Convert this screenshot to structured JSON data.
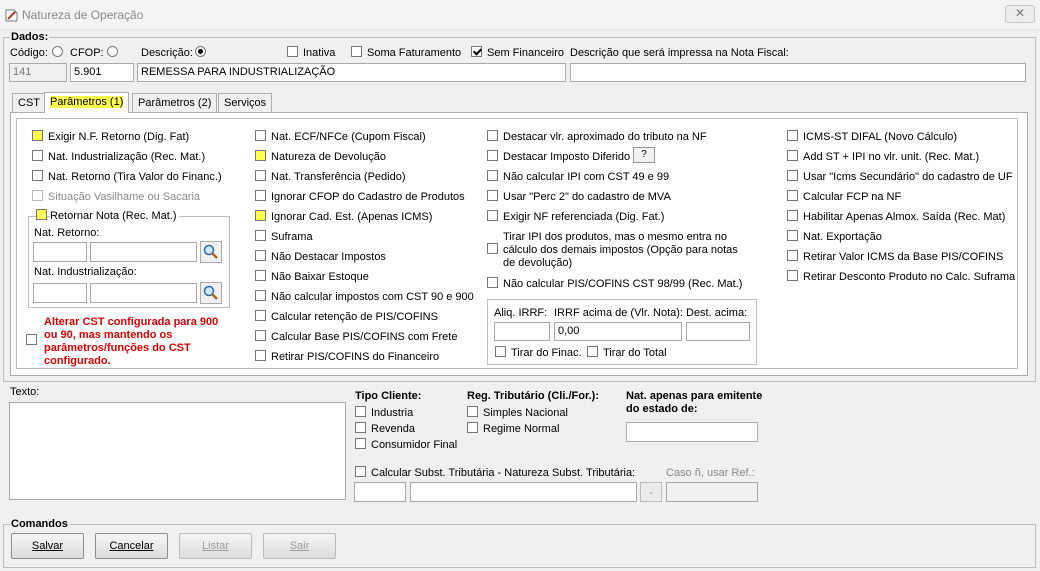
{
  "window": {
    "title": "Natureza de Operação",
    "close": "✕"
  },
  "dados": {
    "legend": "Dados:",
    "codigo_label": "Código:",
    "cfop_label": "CFOP:",
    "descricao_label": "Descrição:",
    "inativa": "Inativa",
    "soma_faturamento": "Soma Faturamento",
    "sem_financeiro": "Sem Financeiro",
    "desc_nf_label": "Descrição que será impressa na Nota Fiscal:",
    "codigo": "141",
    "cfop": "5.901",
    "descricao": "REMESSA PARA INDUSTRIALIZAÇÃO",
    "desc_nf": ""
  },
  "tabs": [
    "CST",
    "Parâmetros (1)",
    "Parâmetros (2)",
    "Serviços"
  ],
  "col1": {
    "exigir_nf": "Exigir N.F. Retorno (Dig. Fat)",
    "nat_industrializacao": "Nat. Industrialização (Rec. Mat.)",
    "nat_retorno": "Nat. Retorno (Tira Valor do Financ.)",
    "situacao_vasilhame": "Situação Vasilhame ou Sacaria",
    "retornar_nota": "Retornar Nota (Rec. Mat.)",
    "nat_retorno_label": "Nat. Retorno:",
    "nat_ind_label": "Nat. Industrialização:",
    "alerta": "Alterar CST configurada para 900 ou 90, mas mantendo os parâmetros/funções do CST configurado."
  },
  "col2": [
    "Nat. ECF/NFCe (Cupom Fiscal)",
    "Natureza de Devolução",
    "Nat. Transferência (Pedido)",
    "Ignorar CFOP do Cadastro de Produtos",
    "Ignorar Cad. Est. (Apenas ICMS)",
    "Suframa",
    "Não Destacar Impostos",
    "Não Baixar Estoque",
    "Não calcular impostos com CST 90 e 900",
    "Calcular retenção de PIS/COFINS",
    "Calcular Base PIS/COFINS com Frete",
    "Retirar PIS/COFINS do Financeiro"
  ],
  "col3": {
    "destacar_vlr": "Destacar vlr. aproximado do tributo na NF",
    "destacar_diferido": "Destacar Imposto Diferido",
    "help": "?",
    "nao_calcular_ipi": "Não calcular IPI com CST 49 e 99",
    "usar_perc2": "Usar \"Perc 2\" do cadastro de MVA",
    "exigir_nf_ref": "Exigir NF referenciada (Dig. Fat.)",
    "tirar_ipi": "Tirar IPI dos produtos, mas o mesmo entra no cálculo dos demais impostos (Opção para notas de devolução)",
    "nao_calcular_pis": "Não calcular PIS/COFINS CST 98/99 (Rec. Mat.)",
    "aliq_irrf": "Aliq. IRRF:",
    "irrf_acima": "IRRF acima de (Vlr. Nota):",
    "dest_acima": "Dest. acima:",
    "irrf_valor": "0,00",
    "tirar_financ": "Tirar do Finac.",
    "tirar_total": "Tirar do Total"
  },
  "col4": [
    "ICMS-ST DIFAL (Novo Cálculo)",
    "Add ST + IPI no vlr. unit. (Rec. Mat.)",
    "Usar \"Icms Secundário\" do cadastro de UF",
    "Calcular FCP na NF",
    "Habilitar Apenas Almox. Saída (Rec. Mat)",
    "Nat. Exportação",
    "Retirar Valor ICMS da Base PIS/COFINS",
    "Retirar Desconto Produto no Calc. Suframa"
  ],
  "texto": {
    "label": "Texto:",
    "value": ""
  },
  "tipo_cliente": {
    "title": "Tipo Cliente:",
    "items": [
      "Industria",
      "Revenda",
      "Consumidor Final"
    ]
  },
  "reg_tributario": {
    "title": "Reg. Tributário (Cli./For.):",
    "items": [
      "Simples Nacional",
      "Regime Normal"
    ]
  },
  "nat_emitente": {
    "title": "Nat. apenas para emitente do estado de:"
  },
  "subst": {
    "label": "Calcular Subst. Tributária - Natureza Subst. Tributária:",
    "caso": "Caso ñ, usar Ref.:"
  },
  "comandos": {
    "legend": "Comandos",
    "salvar": "Salvar",
    "cancelar": "Cancelar",
    "listar": "Listar",
    "sair": "Sair"
  },
  "colors": {
    "highlight": "#ffff4d",
    "alert": "#e00000"
  }
}
